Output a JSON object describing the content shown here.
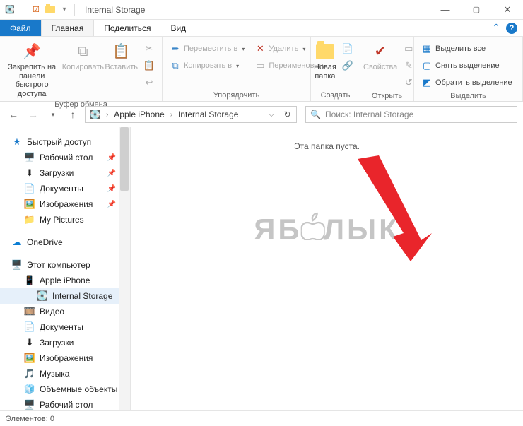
{
  "titlebar": {
    "title": "Internal Storage"
  },
  "menubar": {
    "file": "Файл",
    "home": "Главная",
    "share": "Поделиться",
    "view": "Вид"
  },
  "ribbon": {
    "clipboard": {
      "label": "Буфер обмена",
      "pin": "Закрепить на панели\nбыстрого доступа",
      "copy": "Копировать",
      "paste": "Вставить"
    },
    "organize": {
      "label": "Упорядочить",
      "moveTo": "Переместить в",
      "copyTo": "Копировать в",
      "delete": "Удалить",
      "rename": "Переименовать"
    },
    "create": {
      "label": "Создать",
      "newFolder": "Новая\nпапка"
    },
    "open": {
      "label": "Открыть",
      "properties": "Свойства"
    },
    "select": {
      "label": "Выделить",
      "selectAll": "Выделить все",
      "selectNone": "Снять выделение",
      "invert": "Обратить выделение"
    }
  },
  "address": {
    "segs": [
      "Apple iPhone",
      "Internal Storage"
    ]
  },
  "search": {
    "placeholder": "Поиск: Internal Storage"
  },
  "tree": {
    "quick": "Быстрый доступ",
    "items_quick": [
      {
        "label": "Рабочий стол",
        "icon": "🖥️",
        "pin": true
      },
      {
        "label": "Загрузки",
        "icon": "⬇",
        "pin": true
      },
      {
        "label": "Документы",
        "icon": "📄",
        "pin": true
      },
      {
        "label": "Изображения",
        "icon": "🖼️",
        "pin": true
      },
      {
        "label": "My Pictures",
        "icon": "📁",
        "pin": false
      }
    ],
    "onedrive": "OneDrive",
    "thispc": "Этот компьютер",
    "pc_items": [
      {
        "label": "Apple iPhone",
        "icon": "📱"
      },
      {
        "label": "Internal Storage",
        "icon": "💽",
        "indent": 2,
        "selected": true
      },
      {
        "label": "Видео",
        "icon": "🎞️"
      },
      {
        "label": "Документы",
        "icon": "📄"
      },
      {
        "label": "Загрузки",
        "icon": "⬇"
      },
      {
        "label": "Изображения",
        "icon": "🖼️"
      },
      {
        "label": "Музыка",
        "icon": "🎵"
      },
      {
        "label": "Объемные объекты",
        "icon": "🧊"
      },
      {
        "label": "Рабочий стол",
        "icon": "🖥️"
      }
    ]
  },
  "content": {
    "empty": "Эта папка пуста."
  },
  "watermark": "ЯБЛЫК",
  "status": {
    "items": "Элементов: 0"
  }
}
